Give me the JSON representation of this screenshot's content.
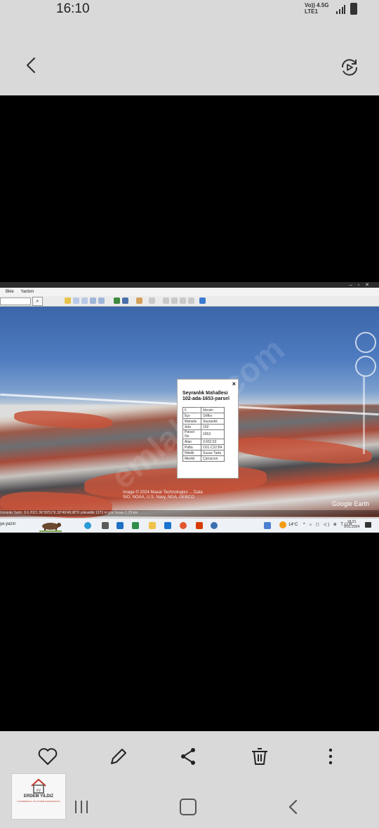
{
  "status_bar": {
    "time": "16:10",
    "network_line1": "Vo)) 4.5G",
    "network_line2": "LTE1"
  },
  "top_bar": {
    "back_icon": "chevron-left-icon",
    "rotate_icon": "rotate-screen-icon"
  },
  "screenshot": {
    "menu": [
      "Bkle",
      "Yardım"
    ],
    "popup": {
      "title_line1": "Seyranlık Mahallesi",
      "title_line2": "102-ada-1653-parsel",
      "close": "×",
      "rows": [
        {
          "key": "İl",
          "value": "Mersin"
        },
        {
          "key": "İlçe",
          "value": "Silifke"
        },
        {
          "key": "Mahalle",
          "value": "Seyranlık"
        },
        {
          "key": "Ada",
          "value": "102"
        },
        {
          "key": "Parsel No",
          "value": "1653"
        },
        {
          "key": "Alan",
          "value": "3.652,53"
        },
        {
          "key": "Pafta",
          "value": "O31.C22.B4"
        },
        {
          "key": "Nitelik",
          "value": "Susuz Tarla"
        },
        {
          "key": "Mevkii",
          "value": "Çürüzcen"
        }
      ]
    },
    "attribution": "Image © 2024 Maxar Technologies ... Data SIO, NOAA, U.S. Navy, NGA, GEBCO",
    "google_earth": "Google Earth",
    "status_line": "Görüntü Tarihi: 8.6.2021   36°39'51\"K   33°49'48.98\"D   yükseklik 1271 m      göz hızası 1.29 km",
    "taskbar": {
      "search_text": "ya yazın",
      "temperature": "14°C",
      "tray": "^ ⌂ ◻ ◁) ⊕ TUR",
      "clock_time": "15:21",
      "clock_date": "9.01.2024"
    },
    "watermark": "emlakjet.com"
  },
  "bottom_actions": [
    "heart-icon",
    "edit-pencil-icon",
    "share-icon",
    "trash-icon",
    "more-vertical-icon"
  ],
  "logo": {
    "name": "ERDEM YILDIZ",
    "subtitle": "GAYRİMENKUL VE YATIRIM DANIŞMANLIĞI"
  }
}
